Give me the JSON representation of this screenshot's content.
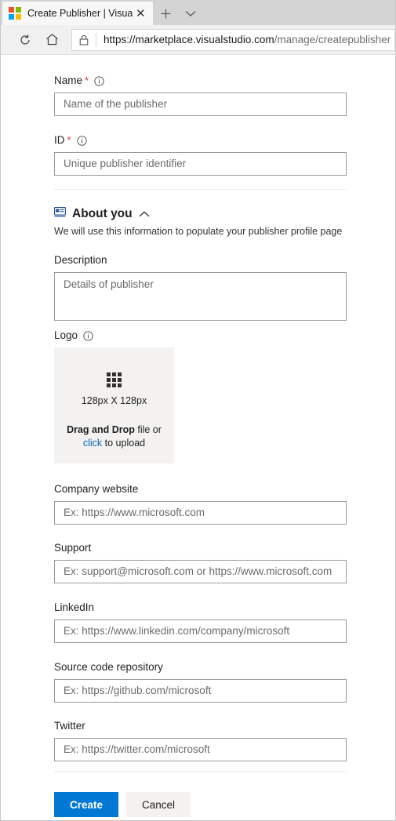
{
  "browser": {
    "tab": {
      "title": "Create Publisher | Visua",
      "favicon": "microsoft-logo-icon",
      "close_label": "✕",
      "new_tab_label": "+",
      "tab_menu_label": "⌄"
    },
    "toolbar": {
      "refresh_label": "refresh-icon",
      "home_label": "home-icon"
    },
    "address": {
      "lock_label": "lock-icon",
      "url_bold": "https://marketplace.visualstudio.com",
      "url_rest": "/manage/createpublisher"
    }
  },
  "form": {
    "name": {
      "label": "Name",
      "required_marker": "*",
      "placeholder": "Name of the publisher",
      "value": ""
    },
    "id": {
      "label": "ID",
      "required_marker": "*",
      "placeholder": "Unique publisher identifier",
      "value": ""
    },
    "about": {
      "icon": "id-card-icon",
      "title": "About you",
      "collapse_icon": "chevron-up-icon",
      "subtitle": "We will use this information to populate your publisher profile page"
    },
    "description": {
      "label": "Description",
      "placeholder": "Details of publisher",
      "value": ""
    },
    "logo": {
      "label": "Logo",
      "dimensions": "128px X 128px",
      "drag_bold": "Drag and Drop",
      "drag_rest": " file or",
      "click_link": "click",
      "upload_rest": " to upload"
    },
    "company_website": {
      "label": "Company website",
      "placeholder": "Ex: https://www.microsoft.com",
      "value": ""
    },
    "support": {
      "label": "Support",
      "placeholder": "Ex: support@microsoft.com or https://www.microsoft.com",
      "value": ""
    },
    "linkedin": {
      "label": "LinkedIn",
      "placeholder": "Ex: https://www.linkedin.com/company/microsoft",
      "value": ""
    },
    "source_code": {
      "label": "Source code repository",
      "placeholder": "Ex: https://github.com/microsoft",
      "value": ""
    },
    "twitter": {
      "label": "Twitter",
      "placeholder": "Ex: https://twitter.com/microsoft",
      "value": ""
    },
    "actions": {
      "create_label": "Create",
      "cancel_label": "Cancel"
    }
  },
  "colors": {
    "accent": "#0078d4",
    "link": "#0067b8",
    "required": "#d13438",
    "field_border": "#9a9a9a",
    "dropzone_bg": "#f3f2f1"
  }
}
